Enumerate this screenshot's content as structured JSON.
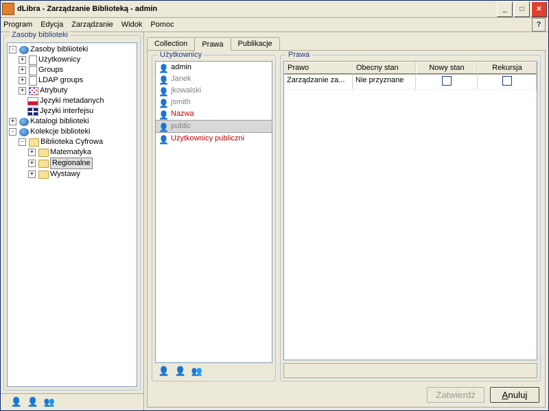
{
  "title": "dLibra - Zarządzanie Biblioteką - admin",
  "menu": {
    "program": "Program",
    "edycja": "Edycja",
    "zarzadzanie": "Zarządzanie",
    "widok": "Widok",
    "pomoc": "Pomoc"
  },
  "left": {
    "legend": "Zasoby biblioteki",
    "tree": {
      "zasoby": "Zasoby bibliioteki",
      "uzytkownicy": "Użytkownicy",
      "groups": "Groups",
      "ldap": "LDAP groups",
      "atrybuty": "Atrybuty",
      "jez_meta": "Języki metadanych",
      "jez_int": "Języki interfejsu",
      "katalogi": "Katalogi biblioteki",
      "kolekcje": "Kolekcje biblioteki",
      "bibcyf": "Biblioteka Cyfrowa",
      "mat": "Matematyka",
      "reg": "Regionalne",
      "wyst": "Wystawy"
    }
  },
  "tabs": {
    "collection": "Collection",
    "prawa": "Prawa",
    "publikacje": "Publikacje"
  },
  "users": {
    "legend": "Użytkownicy",
    "list": [
      {
        "label": "admin",
        "cls": ""
      },
      {
        "label": "Janek",
        "cls": "gray"
      },
      {
        "label": "jkowalski",
        "cls": "gray"
      },
      {
        "label": "jsmith",
        "cls": "gray"
      },
      {
        "label": "Nazwa",
        "cls": "red"
      },
      {
        "label": "public",
        "cls": "selgrp"
      },
      {
        "label": "Użytkownicy publiczni",
        "cls": "red"
      }
    ]
  },
  "rights": {
    "legend": "Prawa",
    "cols": {
      "c0": "Prawo",
      "c1": "Obecny stan",
      "c2": "Nowy stan",
      "c3": "Rekursja"
    },
    "rows": [
      {
        "c0": "Zarządzanie za...",
        "c1": "Nie przyznane"
      }
    ]
  },
  "buttons": {
    "zatwierdz": "Zatwierdź",
    "anuluj_pre": "",
    "anuluj_u": "A",
    "anuluj_post": "nuluj"
  }
}
